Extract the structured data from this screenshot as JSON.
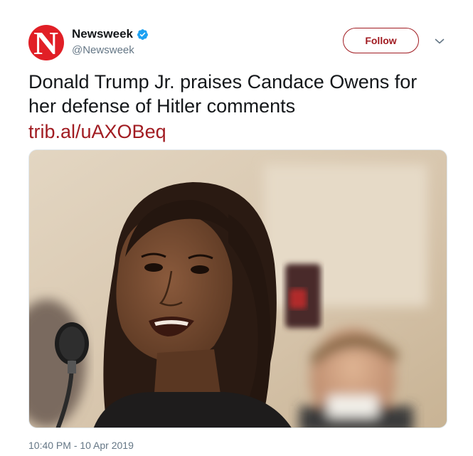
{
  "tweet": {
    "author": {
      "display_name": "Newsweek",
      "handle": "@Newsweek",
      "avatar_letter": "N",
      "avatar_color": "#e11f26",
      "verified": true,
      "verified_icon": "verified-badge-icon"
    },
    "follow_label": "Follow",
    "menu_icon": "chevron-down-icon",
    "text": "Donald Trump Jr. praises Candace Owens for her defense of Hitler comments",
    "link_text": "trib.al/uAXOBeq",
    "media": {
      "type": "photo",
      "description_icon": "news-photo"
    },
    "timestamp": "10:40 PM - 10 Apr 2019"
  },
  "colors": {
    "brand": "#a11c22",
    "verified_blue": "#1da1f2",
    "muted_text": "#657786"
  }
}
